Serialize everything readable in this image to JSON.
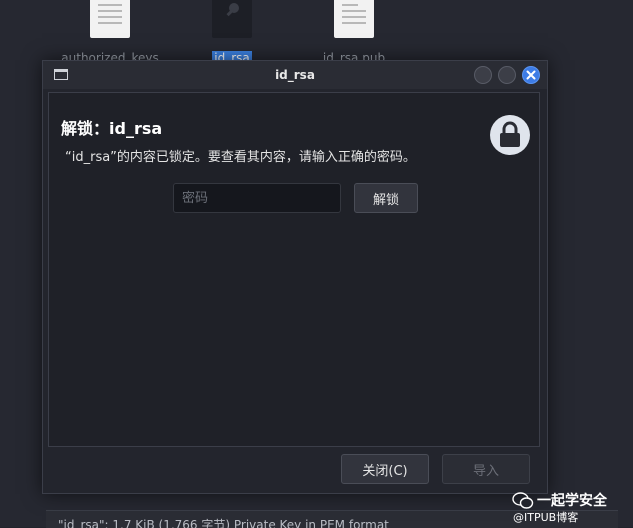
{
  "background": {
    "files": [
      {
        "label": "authorized_keys",
        "icon": "text-file-icon"
      },
      {
        "label": "id_rsa",
        "icon": "key-file-icon",
        "selected": true
      },
      {
        "label": "id_rsa.pub",
        "icon": "text-file-icon"
      }
    ],
    "status_text": "\"id_rsa\": 1.7 KiB (1,766 字节) Private Key in PEM format"
  },
  "dialog": {
    "title": "id_rsa",
    "heading": "解锁：id_rsa",
    "description": "“id_rsa”的内容已锁定。要查看其内容，请输入正确的密码。",
    "password_placeholder": "密码",
    "password_value": "",
    "unlock_label": "解锁",
    "close_label": "关闭(C)",
    "import_label": "导入",
    "icons": {
      "lock": "lock-icon",
      "window": "window-icon"
    }
  },
  "watermark": {
    "title": "一起学安全",
    "subtitle": "@ITPUB博客"
  },
  "colors": {
    "accent": "#3d7ce6",
    "background": "#22242c"
  }
}
